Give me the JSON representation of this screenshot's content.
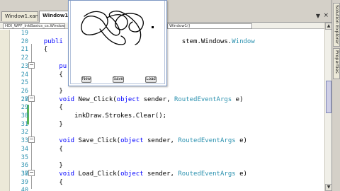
{
  "tabs": [
    {
      "label": "Window1.xaml",
      "active": false
    },
    {
      "label": "Window1.xa",
      "active": true
    }
  ],
  "tab_right_arrow": "▼",
  "tab_close": "×",
  "nav": {
    "class_combo": "HDI_WPF_InkBasics_cs.Window",
    "member_combo": "Window1()"
  },
  "code_lines": [
    {
      "n": "19",
      "text": ""
    },
    {
      "n": "20",
      "kw": "publi",
      "rest_kw": "",
      "tail": "",
      "ty2": "stem.Windows.Window",
      "pre2": ""
    },
    {
      "n": "21",
      "text": "    {"
    },
    {
      "n": "22",
      "text": ""
    },
    {
      "n": "23",
      "text": "        pu"
    },
    {
      "n": "24",
      "text": "        {"
    },
    {
      "n": "25",
      "text": ""
    },
    {
      "n": "26",
      "text": "        }"
    },
    {
      "n": "27",
      "text": ""
    },
    {
      "n": "28",
      "text": "        void New_Click(object sender, RoutedEventArgs e)"
    },
    {
      "n": "29",
      "text": "        {"
    },
    {
      "n": "30",
      "text": "            inkDraw.Strokes.Clear();"
    },
    {
      "n": "31",
      "text": "        }"
    },
    {
      "n": "32",
      "text": ""
    },
    {
      "n": "33",
      "text": "        void Save_Click(object sender, RoutedEventArgs e)"
    },
    {
      "n": "34",
      "text": "        {"
    },
    {
      "n": "35",
      "text": ""
    },
    {
      "n": "36",
      "text": "        }"
    },
    {
      "n": "37",
      "text": ""
    },
    {
      "n": "38",
      "text": "        void Load_Click(object sender, RoutedEventArgs e)"
    },
    {
      "n": "39",
      "text": "        {"
    },
    {
      "n": "40",
      "text": ""
    }
  ],
  "code": {
    "l19": "19",
    "l20_num": "20",
    "l20_kw": "publi",
    "l20_tail": "stem.Windows.",
    "l20_type": "Window",
    "l21_num": "21",
    "l21": "{",
    "l22_num": "22",
    "l23_num": "23",
    "l23": "pu",
    "l24_num": "24",
    "l24": "{",
    "l25_num": "25",
    "l26_num": "26",
    "l26": "}",
    "l27_num": "27",
    "l28_num": "28",
    "void": "void",
    "object": "object",
    "new_click": "New_Click(",
    "save_click": "Save_Click(",
    "load_click": "Load_Click(",
    "sender": " sender, ",
    "args_type": "RoutedEventArgs",
    "args_e": " e)",
    "l29_num": "29",
    "l29": "{",
    "l30_num": "30",
    "l30": "inkDraw.Strokes.Clear();",
    "l31_num": "31",
    "l31": "}",
    "l32_num": "32",
    "l33_num": "33",
    "l34_num": "34",
    "l34": "{",
    "l35_num": "35",
    "l36_num": "36",
    "l36": "}",
    "l37_num": "37",
    "l38_num": "38",
    "l39_num": "39",
    "l39": "{",
    "l40_num": "40"
  },
  "app_window": {
    "buttons": {
      "new": "New",
      "save": "Save",
      "load": "Load"
    }
  },
  "dock_tabs": [
    "Solution Explorer",
    "Properties"
  ],
  "scroll": {
    "up": "▲",
    "down": "▼"
  }
}
